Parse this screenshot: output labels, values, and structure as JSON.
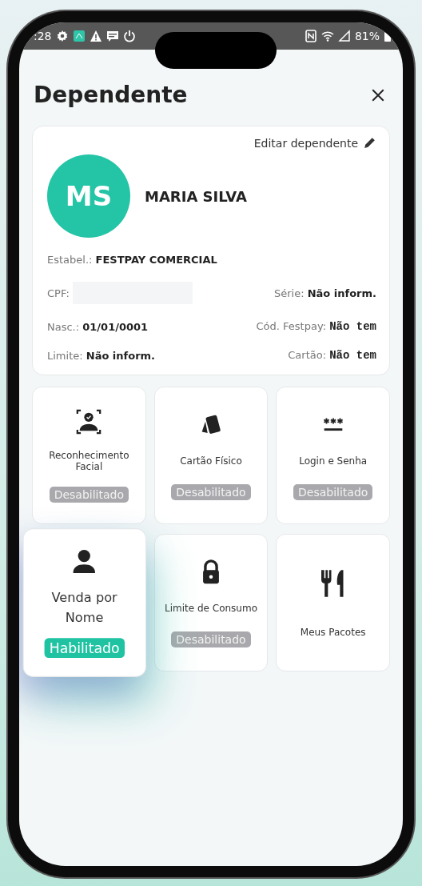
{
  "status_bar": {
    "time": ":28",
    "battery": "81%"
  },
  "header": {
    "title": "Dependente"
  },
  "profile": {
    "edit_link": "Editar dependente",
    "initials": "MS",
    "name": "MARIA SILVA"
  },
  "info_rows": [
    [
      {
        "label": "Estabel.:",
        "value": "FESTPAY COMERCIAL",
        "kind": "text"
      }
    ],
    [
      {
        "label": "CPF:",
        "kind": "redacted"
      },
      {
        "label": "Série:",
        "value": "Não inform.",
        "kind": "text"
      }
    ],
    [
      {
        "label": "Nasc.:",
        "value": "01/01/0001",
        "kind": "text"
      },
      {
        "label": "Cód. Festpay:",
        "value": "Não tem",
        "kind": "code"
      }
    ],
    [
      {
        "label": "Limite:",
        "value": "Não inform.",
        "kind": "text"
      },
      {
        "label": "Cartão:",
        "value": "Não tem",
        "kind": "code"
      }
    ]
  ],
  "tiles": [
    {
      "kind": "face",
      "label": "Reconhecimento Facial",
      "status": "Desabilitado",
      "enabled": false,
      "highlighted": false
    },
    {
      "kind": "cards",
      "label": "Cartão Físico",
      "status": "Desabilitado",
      "enabled": false,
      "highlighted": false
    },
    {
      "kind": "password",
      "label": "Login e Senha",
      "status": "Desabilitado",
      "enabled": false,
      "highlighted": false
    },
    {
      "kind": "person",
      "label": "Venda por Nome",
      "status": "Habilitado",
      "enabled": true,
      "highlighted": true
    },
    {
      "kind": "lock",
      "label": "Limite de Consumo",
      "status": "Desabilitado",
      "enabled": false,
      "highlighted": false
    },
    {
      "kind": "cutlery",
      "label": "Meus Pacotes",
      "highlighted": false
    }
  ]
}
